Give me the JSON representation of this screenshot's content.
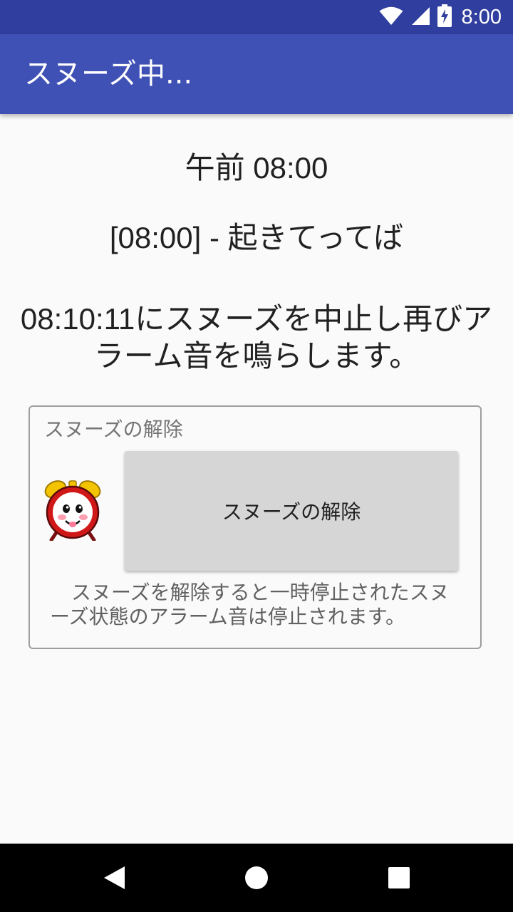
{
  "status_bar": {
    "time": "8:00",
    "icons": [
      "wifi-icon",
      "cellular-signal-icon",
      "battery-charging-icon"
    ]
  },
  "app_bar": {
    "title": "スヌーズ中..."
  },
  "alarm": {
    "time": "午前 08:00",
    "label": "[08:00] - 起きてってば",
    "snooze_message": "08:10:11にスヌーズを中止し再びアラーム音を鳴らします。"
  },
  "snooze_release": {
    "group_title": "スヌーズの解除",
    "button_label": "スヌーズの解除",
    "description": "スヌーズを解除すると一時停止されたスヌーズ状態のアラーム音は停止されます。"
  },
  "nav_bar": {
    "icons": [
      "back-icon",
      "home-icon",
      "recents-icon"
    ]
  },
  "colors": {
    "status_bar": "#303f9f",
    "app_bar": "#3f51b5",
    "background": "#fafafa",
    "button": "#d6d6d6"
  }
}
